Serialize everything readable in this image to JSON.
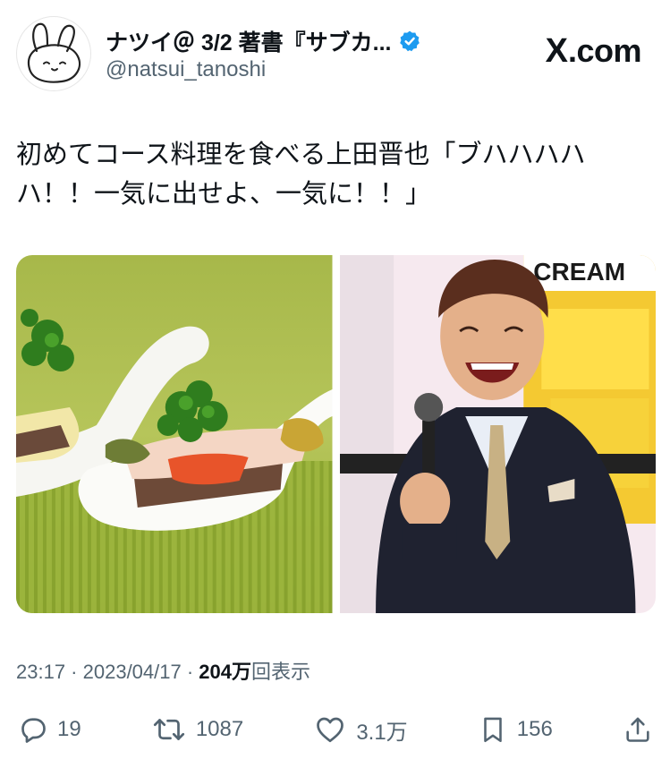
{
  "header": {
    "display_name": "ナツイ＠ 3/2 著書『サブカ...",
    "handle": "@natsui_tanoshi",
    "brand": {
      "mark": "X",
      "text": ".com"
    }
  },
  "tweet": {
    "text": "初めてコース料理を食べる上田晋也「ブハハハハハ！！一気に出せよ、一気に！！」"
  },
  "media": {
    "images": [
      {
        "name": "food-image"
      },
      {
        "name": "host-image",
        "sign_text": "CREAM"
      }
    ]
  },
  "meta": {
    "time": "23:17",
    "separator": " · ",
    "date": "2023/04/17",
    "views_count": "204万",
    "views_label": "回表示"
  },
  "actions": {
    "replies": "19",
    "reposts": "1087",
    "likes": "3.1万",
    "bookmarks": "156"
  },
  "colors": {
    "text": "#0f1419",
    "secondary": "#536471",
    "verified": "#1d9bf0"
  },
  "icons": [
    "avatar-bunny",
    "verified-badge-icon",
    "reply-icon",
    "repost-icon",
    "like-icon",
    "bookmark-icon",
    "share-icon"
  ]
}
